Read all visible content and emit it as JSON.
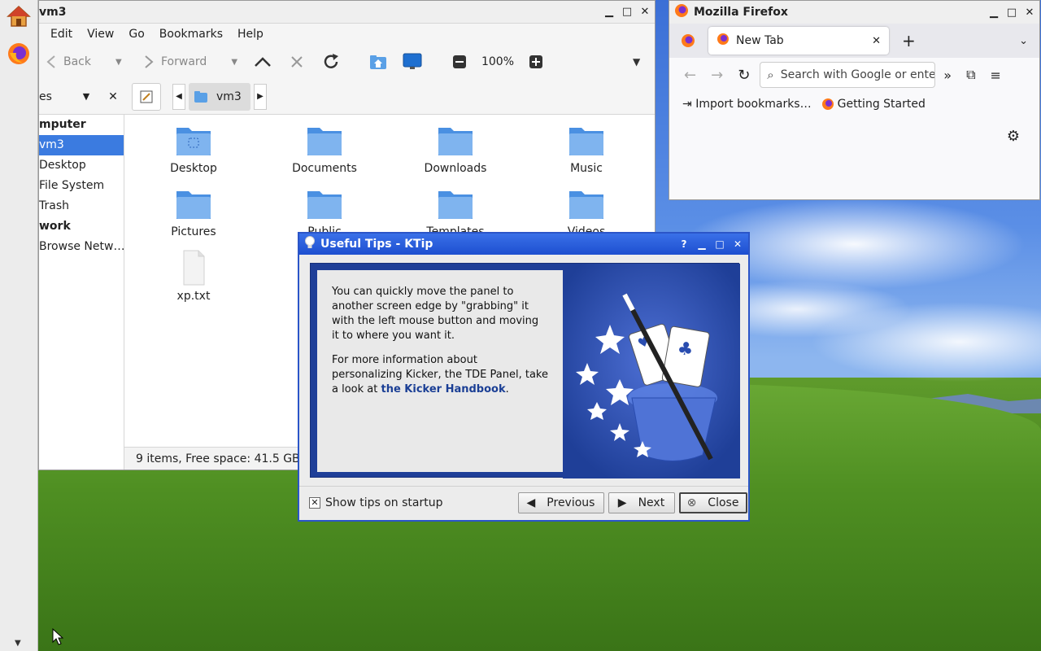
{
  "colors": {
    "selection": "#3b7be0",
    "ktip_title": "#1d4fd0",
    "folder": "#4a90e2",
    "link": "#1b3f95"
  },
  "file_manager": {
    "title": "vm3",
    "menu": [
      "Edit",
      "View",
      "Go",
      "Bookmarks",
      "Help"
    ],
    "toolbar": {
      "back": "Back",
      "forward": "Forward",
      "zoom": "100%"
    },
    "side_pane_label": "es",
    "location_crumb": "vm3",
    "sidebar": [
      {
        "label": "mputer",
        "kind": "head"
      },
      {
        "label": "vm3",
        "kind": "selected"
      },
      {
        "label": "Desktop",
        "kind": "item"
      },
      {
        "label": "File System",
        "kind": "item"
      },
      {
        "label": "Trash",
        "kind": "item"
      },
      {
        "label": "work",
        "kind": "head"
      },
      {
        "label": "Browse Netw…",
        "kind": "item"
      }
    ],
    "files": [
      "Desktop",
      "Documents",
      "Downloads",
      "Music",
      "Pictures",
      "Public",
      "Templates",
      "Videos",
      "xp.txt"
    ],
    "status": "9 items, Free space: 41.5 GB"
  },
  "firefox": {
    "title": "Mozilla Firefox",
    "tab": "New Tab",
    "url_placeholder": "Search with Google or enter address",
    "bookmarks": [
      "Import bookmarks…",
      "Getting Started"
    ]
  },
  "ktip": {
    "title": "Useful Tips - KTip",
    "help_glyph": "?",
    "tip_p1": "You can quickly move the panel to another screen edge by \"grabbing\" it with the left mouse button and moving it to where you want it.",
    "tip_p2_pre": "For more information about personalizing Kicker, the TDE Panel, take a look at ",
    "tip_link": "the Kicker Handbook",
    "tip_p2_post": ".",
    "show_tips": "Show tips on startup",
    "previous": "Previous",
    "next": "Next",
    "close": "Close"
  }
}
